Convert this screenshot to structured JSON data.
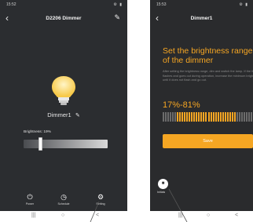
{
  "left_screen": {
    "status_time": "15:52",
    "status_icons": "⚙ ▮",
    "title": "D2206 Dimmer",
    "device_name": "Dimmer1",
    "brightness_label": "Brightness: 19%",
    "brightness_value": 19,
    "tabs": [
      {
        "icon": "power-icon",
        "label": "Power"
      },
      {
        "icon": "clock-icon",
        "label": "Schedule"
      },
      {
        "icon": "gear-icon",
        "label": "Setting"
      }
    ]
  },
  "right_screen": {
    "status_time": "15:53",
    "title": "Dimmer1",
    "headline": "Set the brightness range of the dimmer",
    "description": "After setting the brightness range, dim and switch the lamp. If the light flashes and goes out during operation, increase the minimum brightness until it does not flash and go out.",
    "range_text": "17%-81%",
    "range_min": 17,
    "range_max": 81,
    "save_label": "Save",
    "initial_label": "Initials"
  },
  "navbar": {
    "recent": "|||",
    "home": "○",
    "back": "<"
  },
  "colors": {
    "accent": "#f6a623",
    "background": "#2b2d30"
  }
}
